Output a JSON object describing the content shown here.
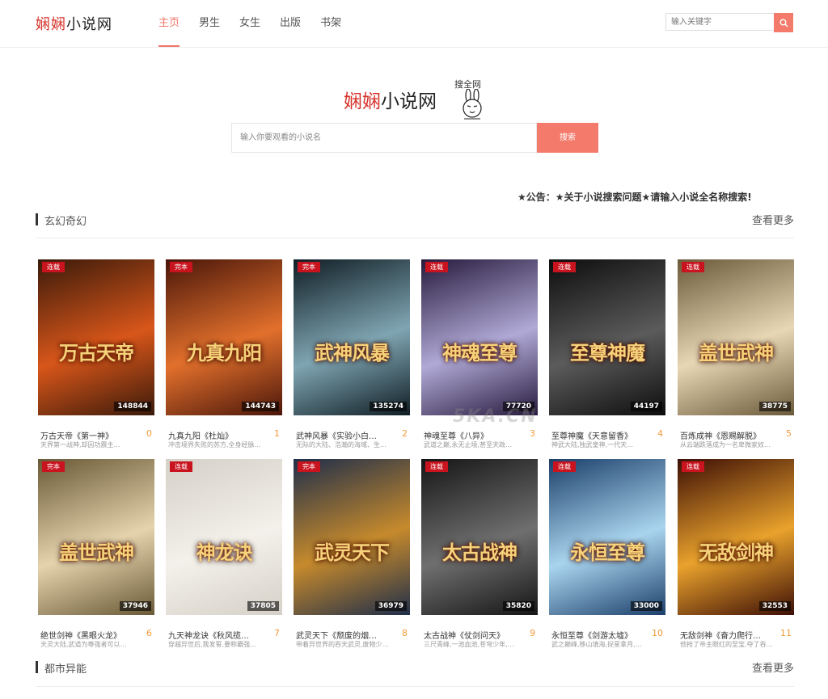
{
  "site": {
    "logo_red": "娴娴",
    "logo_dark": "小说网",
    "hero_red": "娴娴",
    "hero_dark": "小说网",
    "hero_sub": "搜全网"
  },
  "nav": [
    "主页",
    "男生",
    "女生",
    "出版",
    "书架"
  ],
  "top_search": {
    "placeholder": "输入关键字"
  },
  "hero_search": {
    "placeholder": "输入你要观看的小说名",
    "button": "搜索"
  },
  "notice": "★公告：★关于小说搜索问题★请输入小说全名称搜索!",
  "watermark": "5KA.CN",
  "sections": [
    {
      "title": "玄幻奇幻",
      "more": "查看更多",
      "books": [
        {
          "title": "万古天帝《第一神》",
          "desc": "天界第一战神,却因功震主…",
          "badge": "连载",
          "count": "148844",
          "rank": "0",
          "cover_text": "万古天帝",
          "colors": [
            "#3a1a0a",
            "#d8561a"
          ]
        },
        {
          "title": "九真九阳《杜灿》",
          "desc": "冲击境界失败的苏方,全身经脉…",
          "badge": "完本",
          "count": "144743",
          "rank": "1",
          "cover_text": "九真九阳",
          "colors": [
            "#4a160a",
            "#e2702c"
          ]
        },
        {
          "title": "武神风暴《实验小白…",
          "desc": "无际的大陆、浩瀚的海域、生…",
          "badge": "完本",
          "count": "135274",
          "rank": "2",
          "cover_text": "武神风暴",
          "colors": [
            "#0f1d24",
            "#7fa5b2"
          ]
        },
        {
          "title": "神魂至尊《八异》",
          "desc": "武道之巅,永无止境,甚至天政…",
          "badge": "连载",
          "count": "77720",
          "rank": "3",
          "cover_text": "神魂至尊",
          "colors": [
            "#271a3c",
            "#b0a9d6"
          ]
        },
        {
          "title": "至尊神魔《天意留香》",
          "desc": "神武大陆,独武皇神,一代天…",
          "badge": "连载",
          "count": "44197",
          "rank": "4",
          "cover_text": "至尊神魔",
          "colors": [
            "#0d0d0d",
            "#5b5b5b"
          ]
        },
        {
          "title": "百炼成神《恩赐解脱》",
          "desc": "从云端跌落成为一名卑微家奴…",
          "badge": "连载",
          "count": "38775",
          "rank": "5",
          "cover_text": "盖世武神",
          "colors": [
            "#6b5a3a",
            "#e8d7b4"
          ]
        }
      ]
    },
    {
      "books": [
        {
          "title": "绝世剑神《黑眼火龙》",
          "desc": "天灵大陆,武道为尊强者可以…",
          "badge": "完本",
          "count": "37946",
          "rank": "6",
          "cover_text": "盖世武神",
          "colors": [
            "#6a5936",
            "#e5d3ad"
          ]
        },
        {
          "title": "九天神龙诀《秋风揽…",
          "desc": "穿越异世后,我发誓,要称霸强…",
          "badge": "连载",
          "count": "37805",
          "rank": "7",
          "cover_text": "神龙诀",
          "colors": [
            "#d5d0c8",
            "#f3f1ea"
          ]
        },
        {
          "title": "武灵天下《颓废的烟…",
          "desc": "带着异世界的吞天武灵,废物少…",
          "badge": "完本",
          "count": "36979",
          "rank": "8",
          "cover_text": "武灵天下",
          "colors": [
            "#1f2e4a",
            "#c68a2c"
          ]
        },
        {
          "title": "太古战神《仗剑问天》",
          "desc": "三尺青峰,一池血池,苍穹少年,…",
          "badge": "连载",
          "count": "35820",
          "rank": "9",
          "cover_text": "太古战神",
          "colors": [
            "#151515",
            "#6f6f6f"
          ]
        },
        {
          "title": "永恒至尊《剑游太墟》",
          "desc": "武之巅峰,移山填海,捉星拿月,…",
          "badge": "连载",
          "count": "33000",
          "rank": "10",
          "cover_text": "永恒至尊",
          "colors": [
            "#1b3f6a",
            "#a9d4ee"
          ]
        },
        {
          "title": "无敌剑神《奋力爬行…",
          "desc": "他抢了帝主眼红的至宝,夺了吞…",
          "badge": "连载",
          "count": "32553",
          "rank": "11",
          "cover_text": "无敌剑神",
          "colors": [
            "#3d0f06",
            "#e9a22c"
          ]
        }
      ]
    },
    {
      "title": "都市异能",
      "more": "查看更多"
    }
  ]
}
